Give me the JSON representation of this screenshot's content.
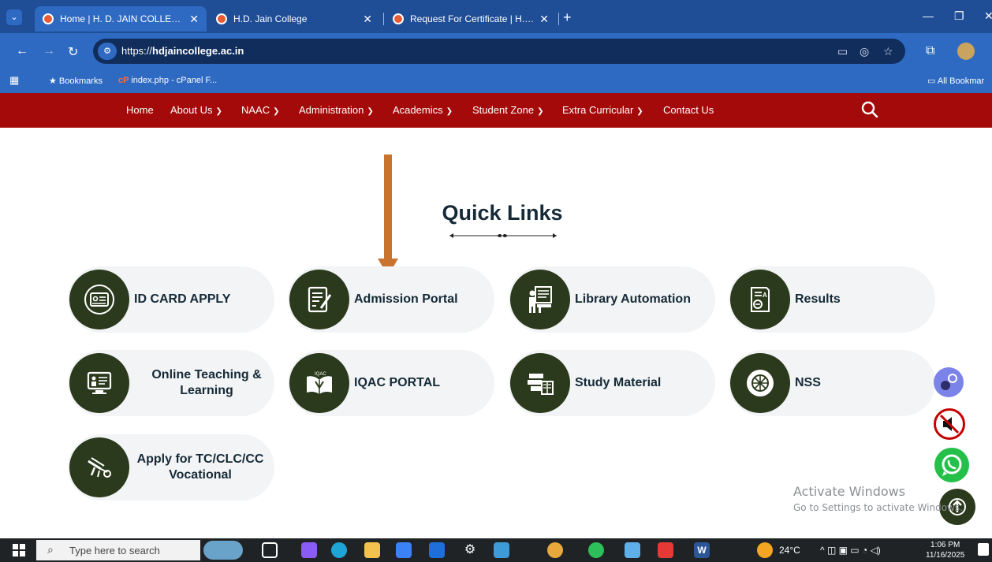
{
  "browser": {
    "tabs": [
      {
        "label": "Home | H. D. JAIN COLLEGE, AR",
        "active": true
      },
      {
        "label": "H.D. Jain College",
        "active": false
      },
      {
        "label": "Request For Certificate | H.D. Ja",
        "active": false
      }
    ],
    "new_tab": "+",
    "url_prefix": "https://",
    "url_domain": "hdjaincollege.ac.in",
    "bookmarks_label": "Bookmarks",
    "bookmark_item": "index.php - cPanel F...",
    "all_bookmarks": "All Bookmar"
  },
  "site_nav": {
    "items": [
      {
        "label": "Home",
        "dropdown": false
      },
      {
        "label": "About Us",
        "dropdown": true
      },
      {
        "label": "NAAC",
        "dropdown": true
      },
      {
        "label": "Administration",
        "dropdown": true
      },
      {
        "label": "Academics",
        "dropdown": true
      },
      {
        "label": "Student Zone",
        "dropdown": true
      },
      {
        "label": "Extra Curricular",
        "dropdown": true
      },
      {
        "label": "Contact Us",
        "dropdown": false
      }
    ],
    "search_icon": "search-icon",
    "color": "#a50a0a"
  },
  "quick_links": {
    "title": "Quick Links",
    "cards": [
      {
        "label": "ID CARD APPLY",
        "icon": "id-card-icon"
      },
      {
        "label": "Admission Portal",
        "icon": "form-edit-icon"
      },
      {
        "label": "Library Automation",
        "icon": "library-icon"
      },
      {
        "label": "Results",
        "icon": "result-certificate-icon"
      },
      {
        "label": "Online Teaching & Learning",
        "icon": "online-teaching-icon"
      },
      {
        "label": "IQAC PORTAL",
        "icon": "iqac-book-icon"
      },
      {
        "label": "Study Material",
        "icon": "study-material-icon"
      },
      {
        "label": "NSS",
        "icon": "nss-emblem-icon"
      },
      {
        "label": "Apply for TC/CLC/CC Vocational",
        "icon": "certificate-apply-icon"
      }
    ],
    "circle_color": "#2b3a1c",
    "arrow_color": "#c8742e"
  },
  "watermark": {
    "line1": "Activate Windows",
    "line2": "Go to Settings to activate Windows."
  },
  "taskbar": {
    "search_placeholder": "Type here to search",
    "temperature": "24°C",
    "time": "1:06 PM",
    "date": "11/16/2025"
  }
}
